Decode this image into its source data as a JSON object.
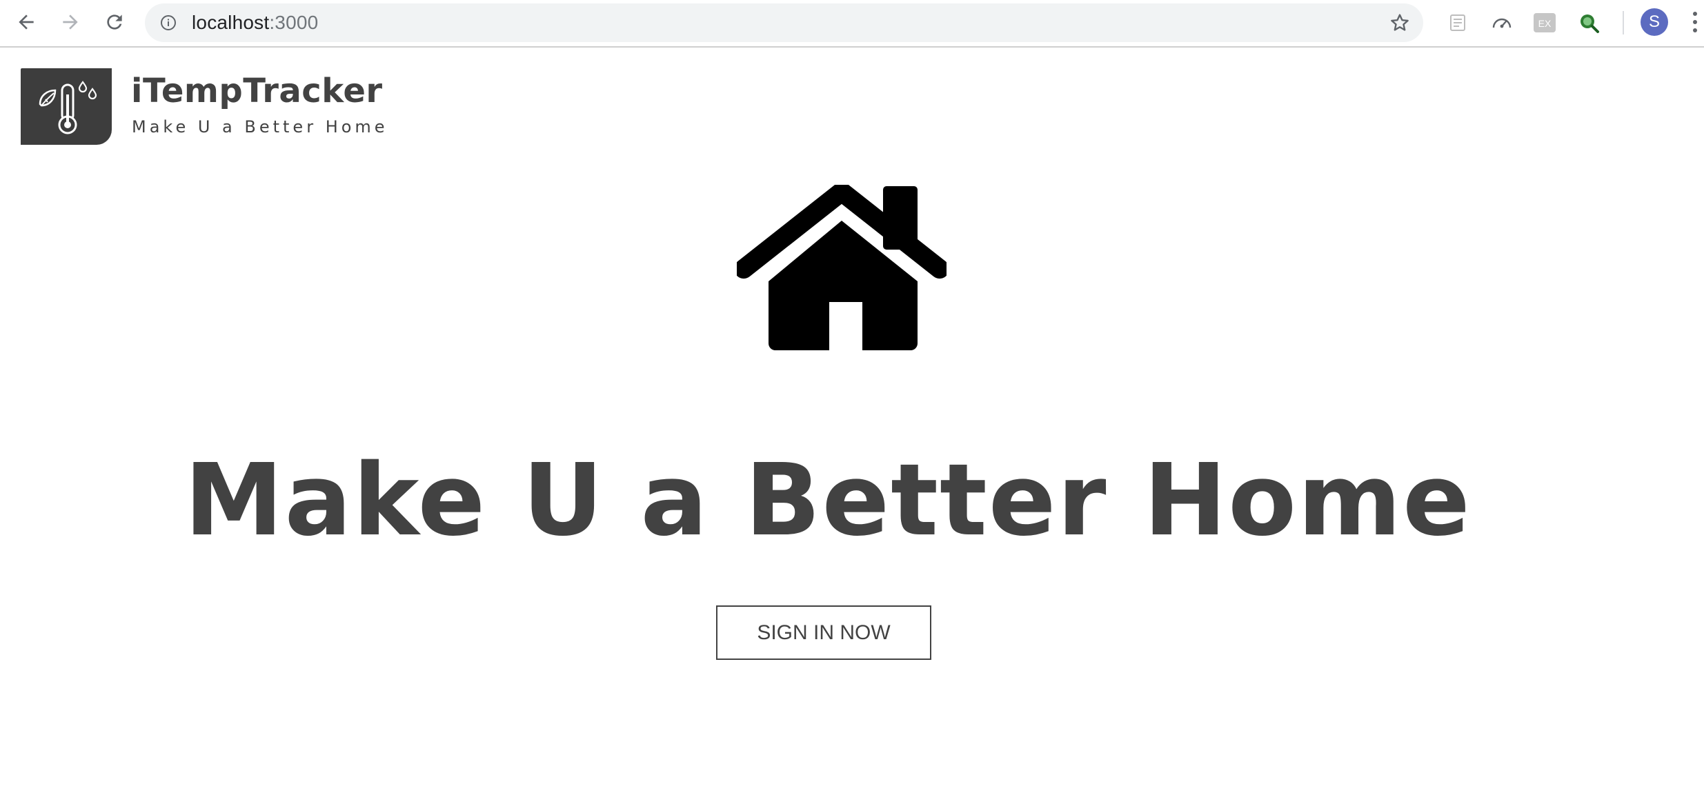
{
  "browser": {
    "url_host": "localhost",
    "url_port": ":3000",
    "profile_initial": "S",
    "extensions": [
      "form-extension-icon",
      "speedometer-extension-icon",
      "ex-extension-icon",
      "magnifier-extension-icon"
    ],
    "ex_badge_label": "EX"
  },
  "header": {
    "app_name": "iTempTracker",
    "tagline": "Make U a Better Home"
  },
  "hero": {
    "title": "Make U a Better Home",
    "cta_label": "SIGN IN NOW"
  },
  "colors": {
    "text": "#424242",
    "logo_bg": "#3d3d3d",
    "avatar": "#5c6bc0",
    "omnibox_bg": "#f1f3f4"
  }
}
